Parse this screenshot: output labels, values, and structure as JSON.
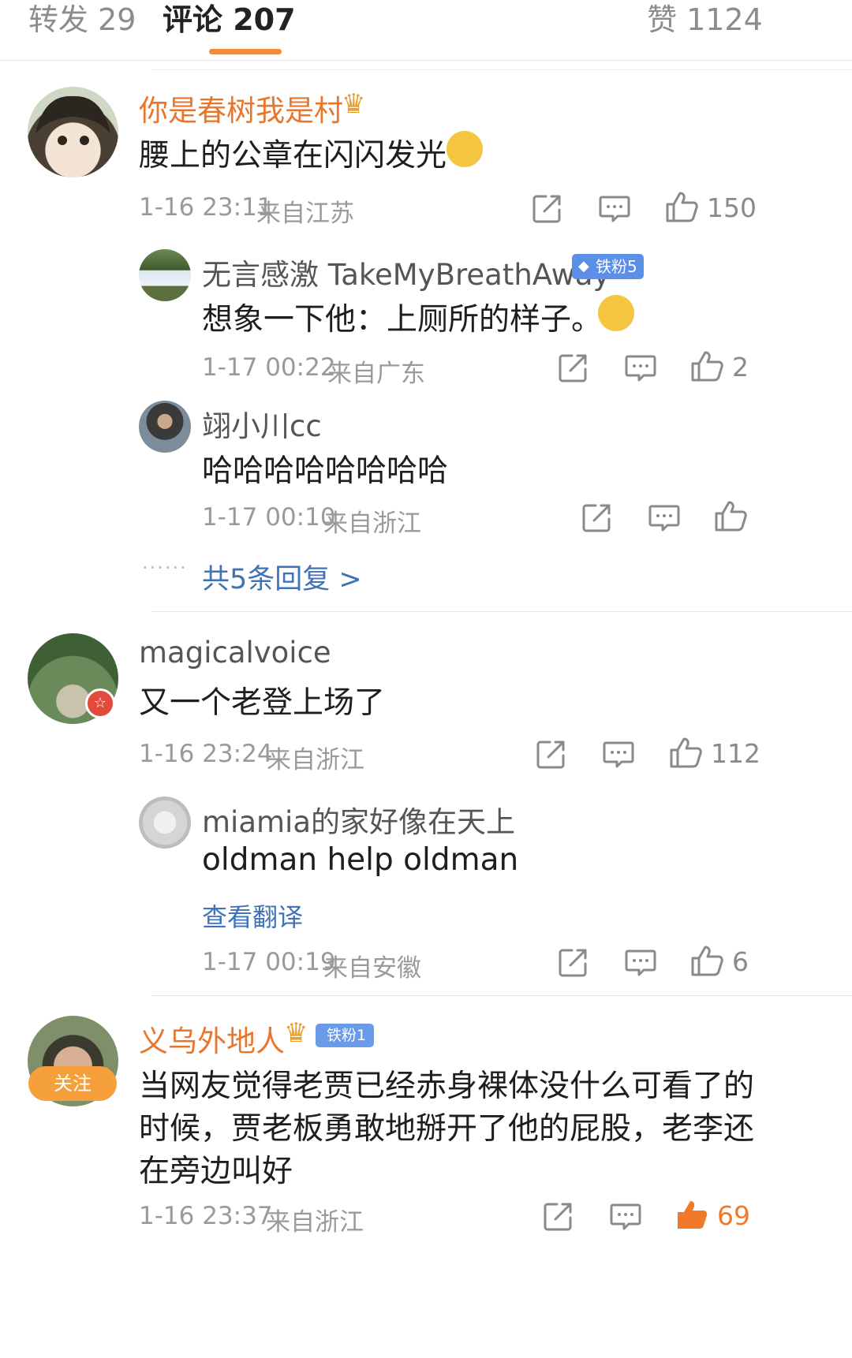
{
  "tabs": [
    {
      "label": "转发 29"
    },
    {
      "label": "评论 207"
    },
    {
      "label": "赞 1124"
    }
  ],
  "comments": [
    {
      "user": "你是春树我是村",
      "text": "腰上的公章在闪闪发光",
      "time": "1-16 23:11",
      "location": "来自江苏",
      "likes": "150",
      "replies": [
        {
          "user": "无言感激 TakeMyBreathAway",
          "badge": "铁粉5",
          "text": "想象一下他：上厕所的样子。",
          "time": "1-17 00:22",
          "location": "来自广东",
          "likes": "2"
        },
        {
          "user": "翊小川cc",
          "text": "哈哈哈哈哈哈哈哈",
          "time": "1-17 00:10",
          "location": "来自浙江",
          "likes": ""
        }
      ],
      "more_replies": "共5条回复 >",
      "dots": "······"
    },
    {
      "user": "magicalvoice",
      "text": "又一个老登上场了",
      "time": "1-16 23:24",
      "location": "来自浙江",
      "likes": "112",
      "replies": [
        {
          "user": "miamia的家好像在天上",
          "text": "oldman help oldman",
          "translate": "查看翻译",
          "time": "1-17 00:19",
          "location": "来自安徽",
          "likes": "6"
        }
      ]
    },
    {
      "user": "义乌外地人",
      "badge": "铁粉1",
      "follow": "关注",
      "text_lines": [
        "当网友觉得老贾已经赤身裸体没什么可看了的",
        "时候，贾老板勇敢地掰开了他的屁股，老李还",
        "在旁边叫好"
      ],
      "time": "1-16 23:37",
      "location": "来自浙江",
      "likes": "69"
    }
  ],
  "colors": {
    "accent": "#f08a3c",
    "link": "#3f72b8",
    "vip_name": "#e8762c",
    "liked": "#f07a2a"
  }
}
